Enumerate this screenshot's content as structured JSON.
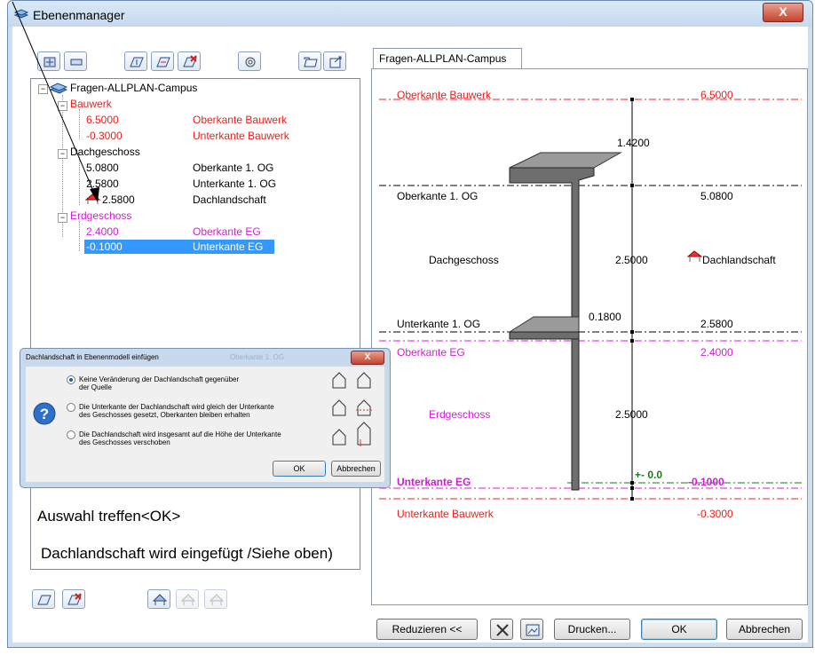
{
  "window": {
    "title": "Ebenenmanager",
    "close_glyph": "X"
  },
  "tree": {
    "root": "Fragen-ALLPLAN-Campus",
    "groups": [
      {
        "name": "Bauwerk",
        "color": "#e8201c",
        "rows": [
          {
            "value": "6.5000",
            "label": "Oberkante Bauwerk"
          },
          {
            "value": "-0.3000",
            "label": "Unterkante Bauwerk"
          }
        ]
      },
      {
        "name": "Dachgeschoss",
        "color": "#000000",
        "rows": [
          {
            "value": "5.0800",
            "label": "Oberkante 1. OG"
          },
          {
            "value": "2.5800",
            "label": "Unterkante 1. OG"
          },
          {
            "value": "2.5800",
            "label": "Dachlandschaft"
          }
        ]
      },
      {
        "name": "Erdgeschoss",
        "color": "#d21bd6",
        "rows": [
          {
            "value": "2.4000",
            "label": "Oberkante EG"
          },
          {
            "value": "-0.1000",
            "label": "Unterkante EG",
            "selected": true
          }
        ]
      }
    ]
  },
  "subdialog": {
    "title": "Dachlandschaft in Ebenenmodell einfügen",
    "title_ghost": "Oberkante 1. OG",
    "options": [
      {
        "line1": "Keine Veränderung der Dachlandschaft gegenüber",
        "line2": "der Quelle",
        "selected": true
      },
      {
        "line1": "Die Unterkante der Dachlandschaft wird gleich der Unterkante",
        "line2": "des Geschosses gesetzt, Oberkanten bleiben erhalten",
        "selected": false
      },
      {
        "line1": "Die Dachlandschaft wird insgesamt auf die Höhe der Unterkante",
        "line2": "des Geschosses verschoben",
        "selected": false
      }
    ],
    "ok_label": "OK",
    "cancel_label": "Abbrechen"
  },
  "notes": {
    "line1": "Auswahl treffen<OK>",
    "line2": "Dachlandschaft wird eingefügt /Siehe oben)"
  },
  "preview": {
    "tab": "Fragen-ALLPLAN-Campus",
    "levels": {
      "ok_bauwerk_label": "Oberkante Bauwerk",
      "ok_bauwerk_value": "6.5000",
      "dim_top": "1.4200",
      "ok_og_label": "Oberkante 1. OG",
      "ok_og_value": "5.0800",
      "dg_label": "Dachgeschoss",
      "dg_dim": "2.5000",
      "dg_roof": "Dachlandschaft",
      "uk_og_label": "Unterkante 1. OG",
      "uk_og_dim": "0.1800",
      "uk_og_value": "2.5800",
      "ok_eg_label": "Oberkante EG",
      "ok_eg_value": "2.4000",
      "eg_label": "Erdgeschoss",
      "eg_dim": "2.5000",
      "zero": "+- 0.0",
      "uk_eg_label": "Unterkante EG",
      "uk_eg_value": "-0.1000",
      "uk_bauwerk_label": "Unterkante Bauwerk",
      "uk_bauwerk_value": "-0.3000"
    }
  },
  "footer": {
    "reduce": "Reduzieren <<",
    "print": "Drucken...",
    "ok": "OK",
    "cancel": "Abbrechen"
  },
  "colors": {
    "red": "#e8201c",
    "magenta": "#d21bd6",
    "selection": "#3399ff",
    "green": "#1a7a1a"
  }
}
